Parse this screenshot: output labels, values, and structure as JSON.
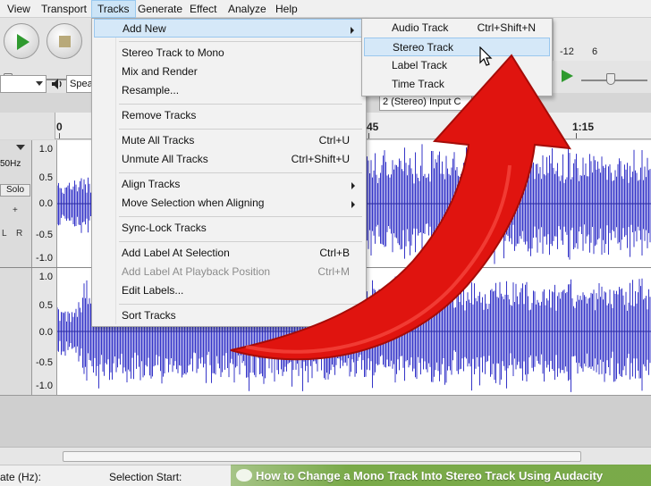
{
  "menubar": {
    "items": [
      "View",
      "Transport",
      "Tracks",
      "Generate",
      "Effect",
      "Analyze",
      "Help"
    ],
    "active": "Tracks"
  },
  "toolbar": {
    "host_value": "",
    "speaker_value": "Spea",
    "channels_value": "2 (Stereo) Input C",
    "meter_label_neg12": "-12",
    "meter_label_neg6": "6"
  },
  "ruler": {
    "labels": [
      "0",
      "45",
      "1:15"
    ]
  },
  "tracks": [
    {
      "rate": "50Hz",
      "solo_label": "Solo",
      "scale": [
        "1.0",
        "0.5",
        "0.0",
        "-0.5",
        "-1.0"
      ]
    },
    {
      "scale": [
        "1.0",
        "0.5",
        "0.0",
        "-0.5",
        "-1.0"
      ]
    }
  ],
  "track_panel_marks": [
    "+",
    "L",
    "R"
  ],
  "tracks_menu": {
    "items": [
      {
        "label": "Add New",
        "shortcut": "",
        "submenu": true,
        "highlighted": true
      },
      {
        "label": "Stereo Track to Mono",
        "shortcut": ""
      },
      {
        "label": "Mix and Render",
        "shortcut": ""
      },
      {
        "label": "Resample...",
        "shortcut": ""
      },
      {
        "label": "Remove Tracks",
        "shortcut": ""
      },
      {
        "label": "Mute All Tracks",
        "shortcut": "Ctrl+U"
      },
      {
        "label": "Unmute All Tracks",
        "shortcut": "Ctrl+Shift+U"
      },
      {
        "label": "Align Tracks",
        "shortcut": "",
        "submenu": true
      },
      {
        "label": "Move Selection when Aligning",
        "shortcut": "",
        "submenu": true
      },
      {
        "label": "Sync-Lock Tracks",
        "shortcut": ""
      },
      {
        "label": "Add Label At Selection",
        "shortcut": "Ctrl+B"
      },
      {
        "label": "Add Label At Playback Position",
        "shortcut": "Ctrl+M",
        "disabled": true
      },
      {
        "label": "Edit Labels...",
        "shortcut": ""
      },
      {
        "label": "Sort Tracks",
        "shortcut": "",
        "submenu": true
      }
    ]
  },
  "add_new_submenu": {
    "items": [
      {
        "label": "Audio Track",
        "shortcut": "Ctrl+Shift+N"
      },
      {
        "label": "Stereo Track",
        "shortcut": "",
        "highlighted": true
      },
      {
        "label": "Label Track",
        "shortcut": ""
      },
      {
        "label": "Time Track",
        "shortcut": ""
      }
    ]
  },
  "statusbar": {
    "rate_label": "ate (Hz):",
    "selection_start_label": "Selection Start:"
  },
  "caption": {
    "text": "How to Change a Mono Track Into Stereo Track Using Audacity"
  },
  "colors": {
    "waveform": "#3535c8",
    "arrow": "#e0140f",
    "menu_highlight": "#d5e8f8",
    "caption_green": "#69a032"
  },
  "icons": [
    "play-icon",
    "stop-icon",
    "speaker-icon",
    "cursor-icon",
    "submenu-arrow-icon",
    "dropdown-arrow-icon"
  ]
}
